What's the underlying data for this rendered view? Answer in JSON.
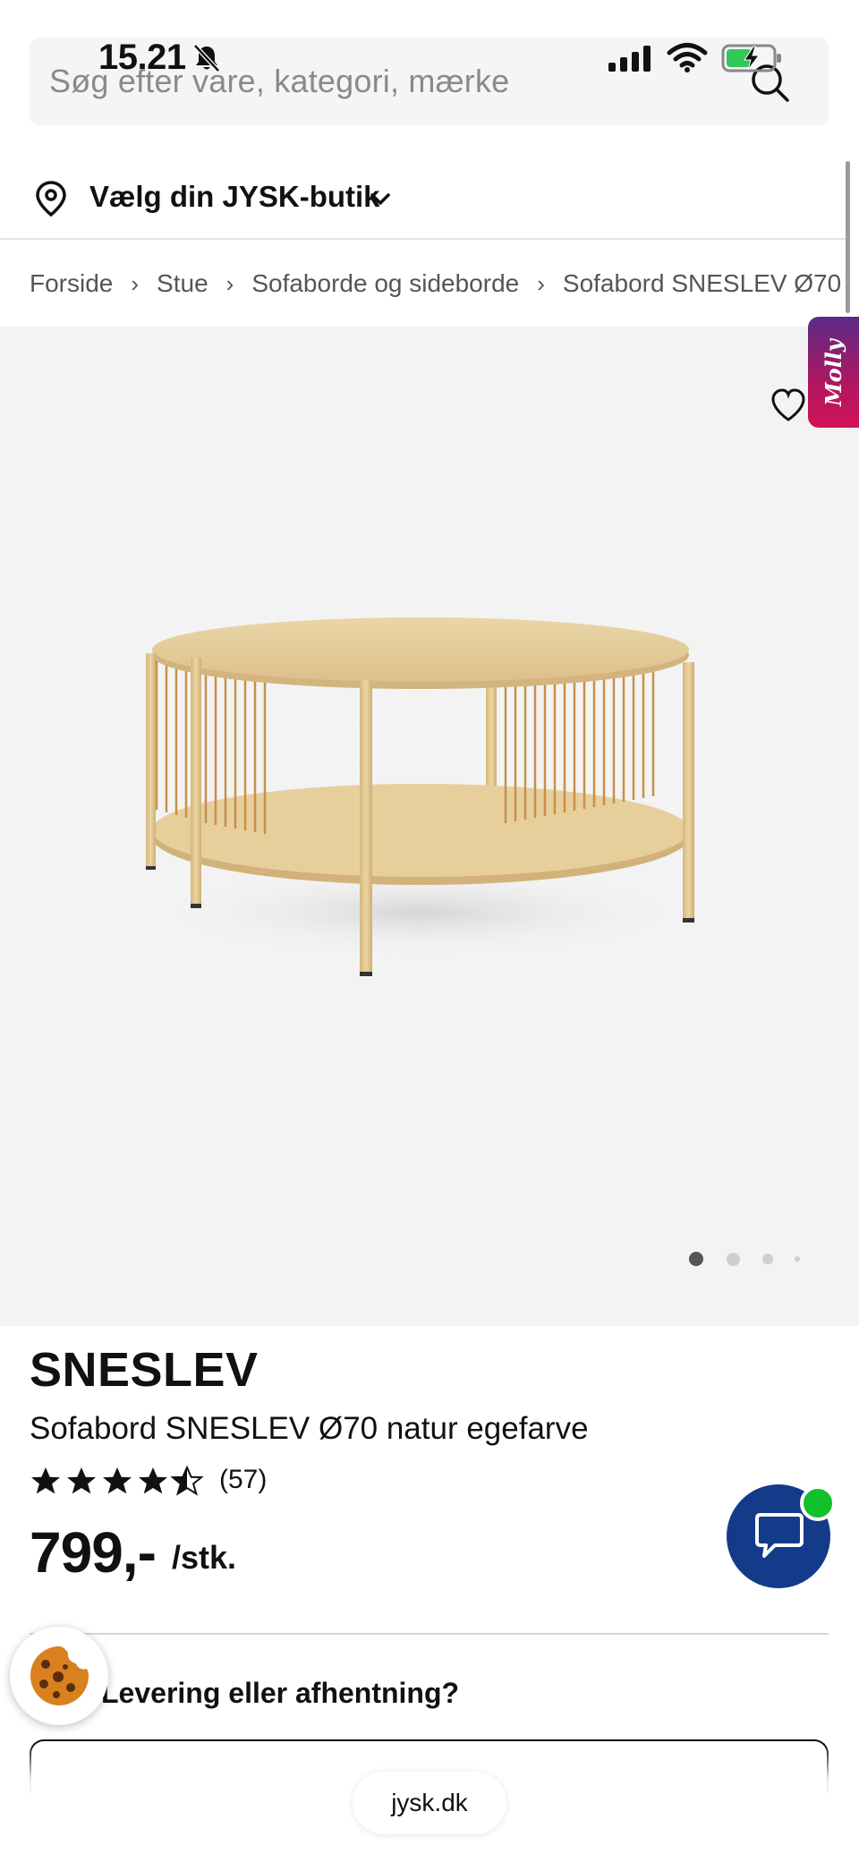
{
  "status_bar": {
    "time": "15.21"
  },
  "search": {
    "placeholder": "Søg efter vare, kategori, mærke"
  },
  "store": {
    "label": "Vælg din JYSK-butik"
  },
  "breadcrumb": [
    "Forside",
    "Stue",
    "Sofaborde og sideborde",
    "Sofabord SNESLEV Ø70"
  ],
  "side_tab": {
    "label": "Molly"
  },
  "carousel": {
    "image_count": 4,
    "active_index": 0
  },
  "product": {
    "brand": "SNESLEV",
    "title": "Sofabord SNESLEV Ø70 natur egefarve",
    "rating": 4.5,
    "rating_max": 5,
    "review_count": "(57)",
    "price": "799,-",
    "price_unit": "/stk."
  },
  "delivery": {
    "heading": "Levering eller afhentning?"
  },
  "browser": {
    "url": "jysk.dk"
  },
  "colors": {
    "chat_button": "#143b8a",
    "chat_badge": "#12c02a",
    "molly_tab": "#b0175f",
    "image_background": "#f3f3f3",
    "search_background": "#f5f5f5"
  },
  "icons": {
    "search": "search-icon",
    "store": "pin-icon",
    "store_chevron": "chevron-down-icon",
    "favorite": "heart-icon",
    "chat": "chat-bubble-icon",
    "cookie": "cookie-icon",
    "rating": "star-icon",
    "notifications": "bell-off-icon",
    "signal": "cellular-signal-icon",
    "wifi": "wifi-icon",
    "battery": "battery-charging-icon"
  }
}
